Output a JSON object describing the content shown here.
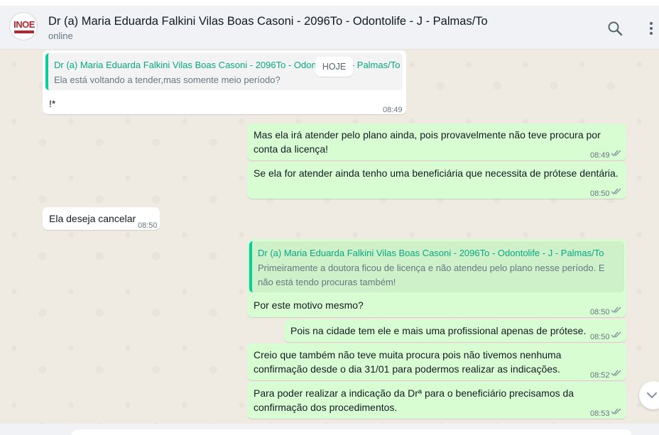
{
  "header": {
    "avatar_text": "INOE",
    "title": "Dr (a) Maria Eduarda Falkini Vilas Boas Casoni - 2096To - Odontolife - J - Palmas/To",
    "status": "online",
    "icons": [
      "search-icon",
      "menu-icon"
    ]
  },
  "chat": {
    "date_label": "HOJE",
    "messages": [
      {
        "direction": "in",
        "quote_name": "Dr (a) Maria Eduarda Falkini Vilas Boas Casoni - 2096To - Odontolife - J - Palmas/To",
        "quote_text": "Ela está voltando a tender,mas somente meio período?",
        "text": "!*",
        "time": "08:49"
      },
      {
        "direction": "out",
        "text_line1": "Mas ela irá atender pelo plano ainda, pois provavelmente não teve procura por",
        "text_line2": "conta da licença!",
        "time": "08:49"
      },
      {
        "direction": "out",
        "text": "Se ela for atender ainda tenho uma beneficiária que necessita de prótese dentária.",
        "time": "08:50"
      },
      {
        "direction": "in",
        "text": "Ela deseja cancelar",
        "time": "08:50"
      },
      {
        "direction": "out",
        "quote_name": "Dr (a) Maria Eduarda Falkini Vilas Boas Casoni - 2096To - Odontolife - J - Palmas/To",
        "quote_line1": "Primeiramente a doutora ficou de licença e não atendeu pelo plano nesse período. E",
        "quote_line2": "não está tendo procuras também!",
        "text": "Por este motivo mesmo?",
        "time": "08:50"
      },
      {
        "direction": "out",
        "text": "Pois na cidade tem ele e mais uma profissional apenas de prótese.",
        "time": "08:50"
      },
      {
        "direction": "out",
        "text_line1": "Creio que também não teve muita procura pois não tivemos nenhuma",
        "text_line2": "confirmação desde o dia 31/01 para podermos realizar as indicações.",
        "time": "08:52"
      },
      {
        "direction": "out",
        "text_line1": "Para poder realizar a indicação da Drª para o beneficiário precisamos da",
        "text_line2": "confirmação dos procedimentos.",
        "time": "08:53"
      }
    ]
  },
  "colors": {
    "outgoing_bubble": "#d9fdd3",
    "incoming_bubble": "#ffffff",
    "quote_accent": "#06cf9c",
    "read_ticks": "#8696a0"
  }
}
